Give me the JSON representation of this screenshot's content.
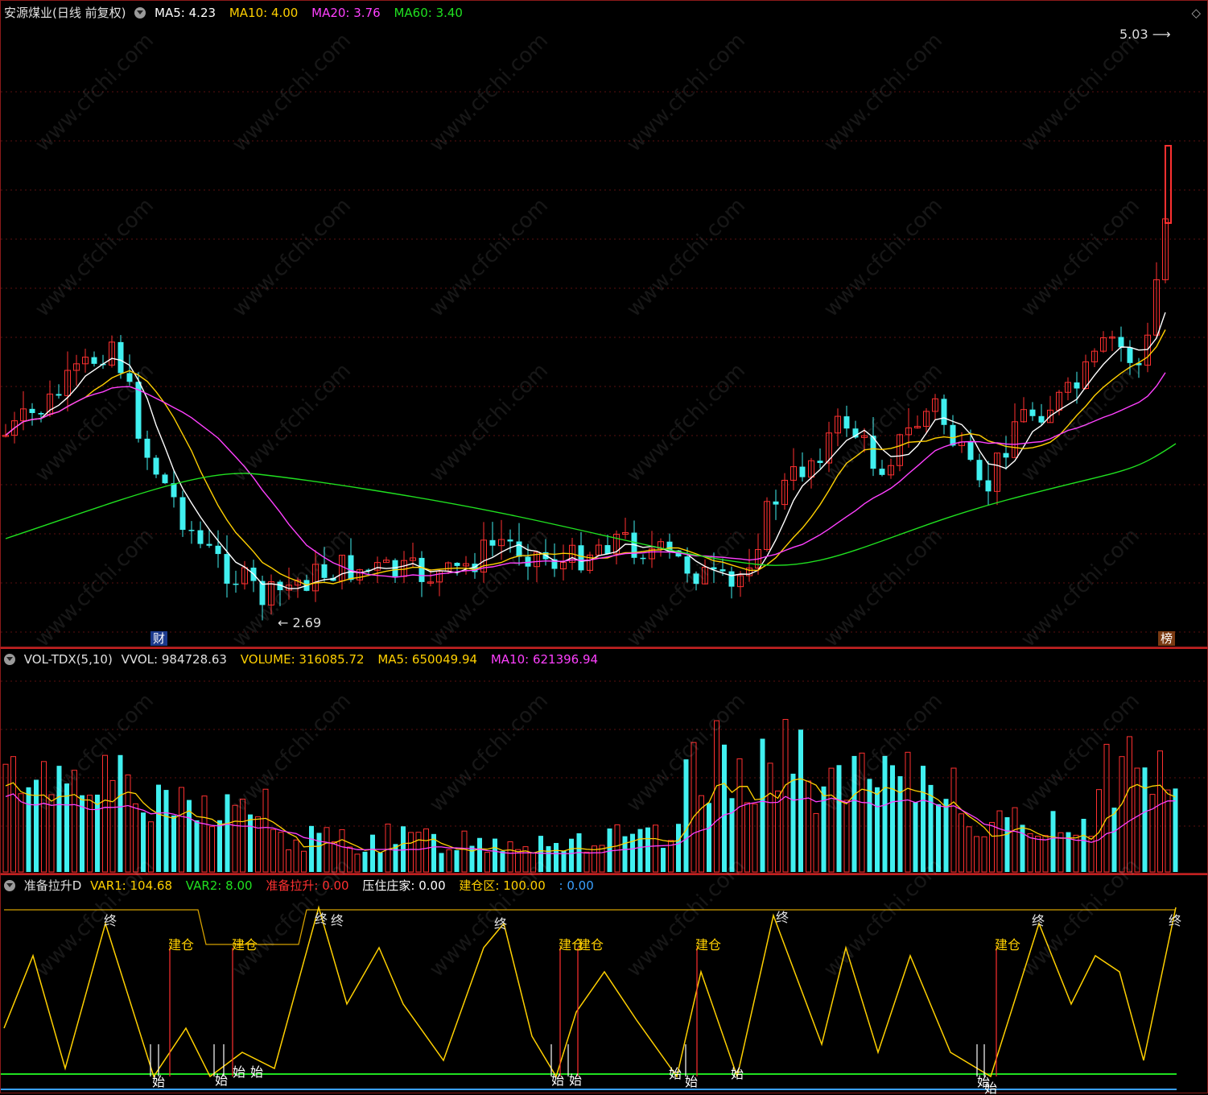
{
  "main_panel": {
    "stock_title": "安源煤业(日线 前复权)",
    "ma5": {
      "label": "MA5:",
      "value": "4.23",
      "color": "#ffffff"
    },
    "ma10": {
      "label": "MA10:",
      "value": "4.00",
      "color": "#ffd000"
    },
    "ma20": {
      "label": "MA20:",
      "value": "3.76",
      "color": "#ff40ff"
    },
    "ma60": {
      "label": "MA60:",
      "value": "3.40",
      "color": "#20e020"
    },
    "high_label": "5.03",
    "low_label": "2.69",
    "tag_cai": "财",
    "tag_bang": "榜",
    "corner_icon": "diamond-icon"
  },
  "volume_panel": {
    "name": "VOL-TDX(5,10)",
    "vvol_label": "VVOL:",
    "vvol": "984728.63",
    "volume_label": "VOLUME:",
    "volume": "316085.72",
    "ma5_label": "MA5:",
    "ma5": "650049.94",
    "ma10_label": "MA10:",
    "ma10": "621396.94"
  },
  "indicator_panel": {
    "name": "准备拉升D",
    "var1_label": "VAR1:",
    "var1": "104.68",
    "var2_label": "VAR2:",
    "var2": "8.00",
    "prep_label": "准备拉升:",
    "prep": "0.00",
    "press_label": "压住庄家:",
    "press": "0.00",
    "build_label": "建仓区:",
    "build": "100.00",
    "extra": ": 0.00",
    "labels": {
      "end": "终",
      "start": "始",
      "build": "建仓"
    }
  },
  "watermark": "www.cfchi.com",
  "colors": {
    "up": "#ff3030",
    "down": "#40f0f0",
    "border": "#8b1a1a"
  }
}
